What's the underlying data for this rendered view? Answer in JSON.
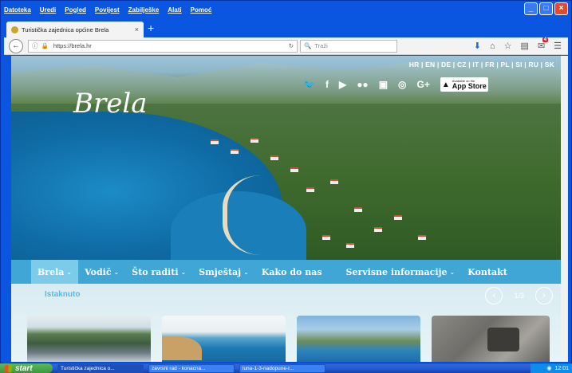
{
  "menubar": [
    "Datoteka",
    "Uredi",
    "Pogled",
    "Povijest",
    "Zabilješke",
    "Alati",
    "Pomoć"
  ],
  "tab": {
    "title": "Turistička zajednica općine Brela",
    "close": "×",
    "new": "+"
  },
  "urlbar": {
    "url": "https://brela.hr",
    "search_placeholder": "Traži",
    "badge": "4"
  },
  "site": {
    "logo": "Brela",
    "languages": "HR | EN | DE | CZ | IT | FR | PL | SI | RU | SK",
    "social": [
      "twitter-icon",
      "facebook-icon",
      "youtube-icon",
      "flickr-icon",
      "instagram-icon",
      "tripadvisor-icon",
      "google-plus-icon"
    ],
    "google_plus": "G+",
    "appstore_small": "Available on the",
    "appstore": "App Store"
  },
  "nav": [
    {
      "label": "Brela",
      "chevron": "⌄"
    },
    {
      "label": "Vodič",
      "chevron": "⌄"
    },
    {
      "label": "Što raditi",
      "chevron": "⌄"
    },
    {
      "label": "Smještaj",
      "chevron": "⌄"
    },
    {
      "label": "Kako do nas",
      "chevron": ""
    },
    {
      "label": "Servisne informacije",
      "chevron": "⌄"
    },
    {
      "label": "Kontakt",
      "chevron": ""
    }
  ],
  "featured": {
    "title": "Istaknuto",
    "page": "1/3"
  },
  "taskbar": {
    "start": "start",
    "tasks": [
      "Turistička zajednica o...",
      "zavrsni rad - konacna...",
      "luna-1-3-nadopune-r..."
    ],
    "time": "12:01"
  }
}
